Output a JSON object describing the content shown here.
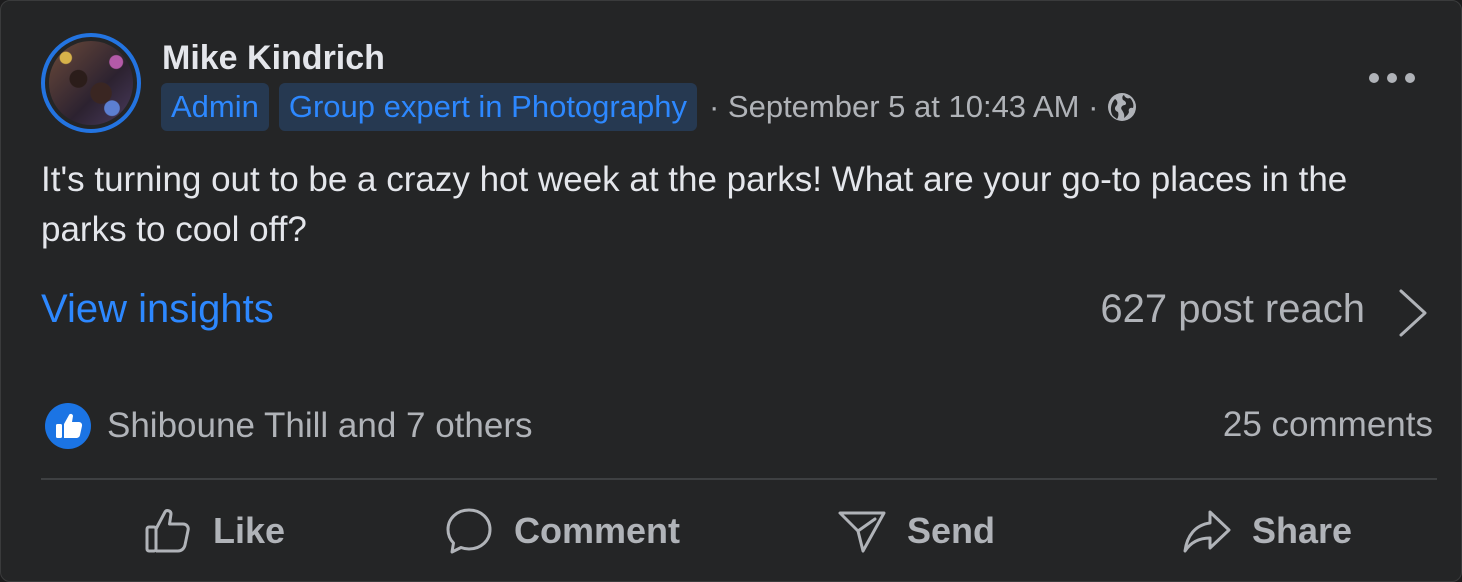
{
  "post": {
    "author": "Mike Kindrich",
    "badges": [
      "Admin",
      "Group expert in Photography"
    ],
    "timestamp": "· September 5 at 10:43 AM ·",
    "privacy_icon": "globe-icon",
    "text": "It's turning out to be a crazy hot week at the parks! What are your go-to places in the parks to cool off?"
  },
  "insights": {
    "link_label": "View insights",
    "reach": "627 post reach"
  },
  "engagement": {
    "reactions": "Shiboune Thill and 7 others",
    "comments": "25 comments"
  },
  "actions": {
    "like": "Like",
    "comment": "Comment",
    "send": "Send",
    "share": "Share"
  },
  "colors": {
    "background": "#242526",
    "accent": "#2d88ff",
    "text_primary": "#e4e6eb",
    "text_secondary": "#b0b3b8"
  }
}
